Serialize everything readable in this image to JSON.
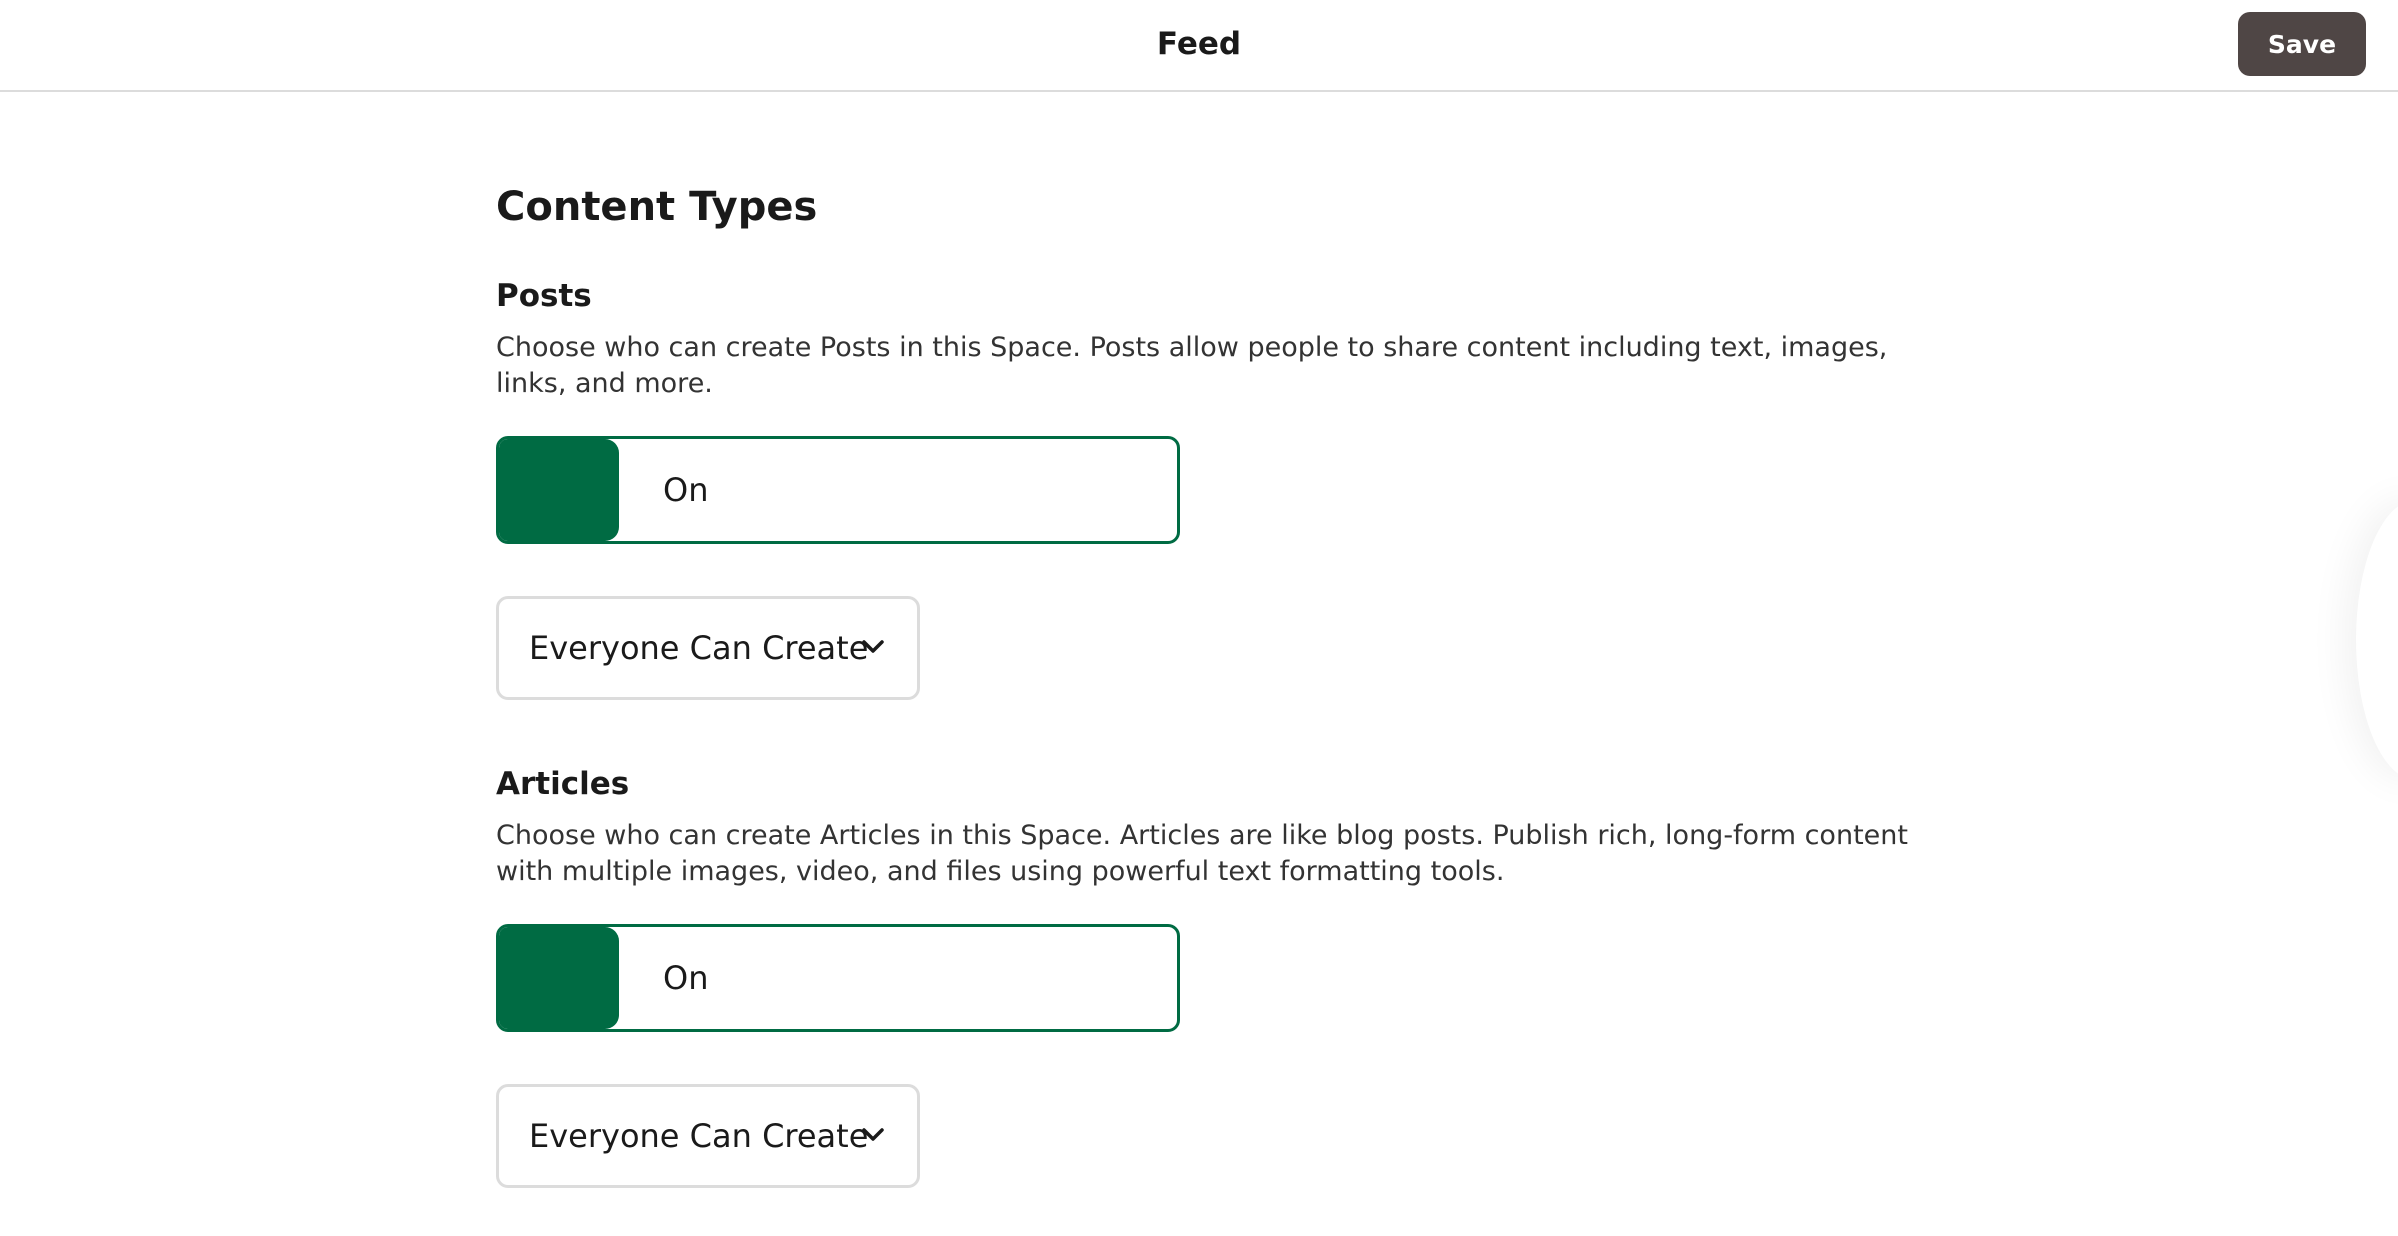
{
  "header": {
    "title": "Feed",
    "save_label": "Save"
  },
  "section": {
    "title": "Content Types"
  },
  "content_types": [
    {
      "heading": "Posts",
      "description": "Choose who can create Posts in this Space. Posts allow people to share content including text, images, links, and more.",
      "toggle_label": "On",
      "select_value": "Everyone Can Create"
    },
    {
      "heading": "Articles",
      "description": "Choose who can create Articles in this Space. Articles are like blog posts. Publish rich, long-form content with multiple images, video, and files using powerful text formatting tools.",
      "toggle_label": "On",
      "select_value": "Everyone Can Create"
    }
  ],
  "colors": {
    "accent": "#006b43",
    "save_button": "#4f4645",
    "border": "#dcdcdc"
  },
  "icons": {
    "dropdown": "chevron-down-icon"
  }
}
